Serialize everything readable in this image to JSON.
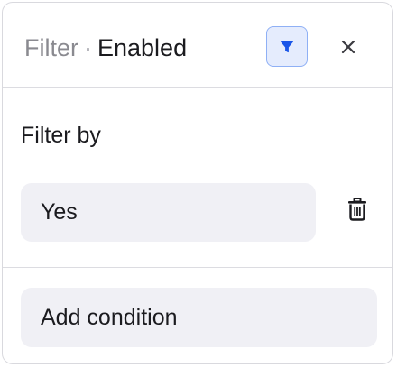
{
  "header": {
    "title_prefix": "Filter",
    "separator": "·",
    "status": "Enabled",
    "filter_icon": "funnel-icon",
    "close_icon": "close-icon"
  },
  "filter": {
    "label": "Filter by",
    "value": "Yes",
    "delete_icon": "trash-icon"
  },
  "actions": {
    "add_condition_label": "Add condition"
  },
  "colors": {
    "accent": "#1a56e8",
    "toggle_bg": "#e5ecfd",
    "pill_bg": "#f0f0f5",
    "text": "#1b1b1f",
    "muted": "#8a8a90"
  }
}
